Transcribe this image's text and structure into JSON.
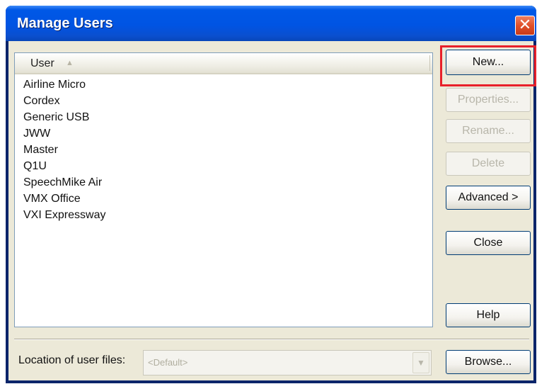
{
  "window": {
    "title": "Manage Users",
    "close_glyph": "✕"
  },
  "list": {
    "column_header": "User",
    "sort_glyph": "▲",
    "users": [
      "Airline Micro",
      "Cordex",
      "Generic USB",
      "JWW",
      "Master",
      "Q1U",
      "SpeechMike Air",
      "VMX Office",
      "VXI Expressway"
    ]
  },
  "buttons": {
    "new": "New...",
    "properties": "Properties...",
    "rename": "Rename...",
    "delete": "Delete",
    "advanced": "Advanced >",
    "close": "Close",
    "help": "Help",
    "browse": "Browse..."
  },
  "location": {
    "label": "Location of user files:",
    "value": "<Default>",
    "dropdown_glyph": "▼"
  },
  "colors": {
    "title_bar": "#0054e3",
    "highlight_box": "#e8202a",
    "dialog_face": "#ece9d8"
  }
}
